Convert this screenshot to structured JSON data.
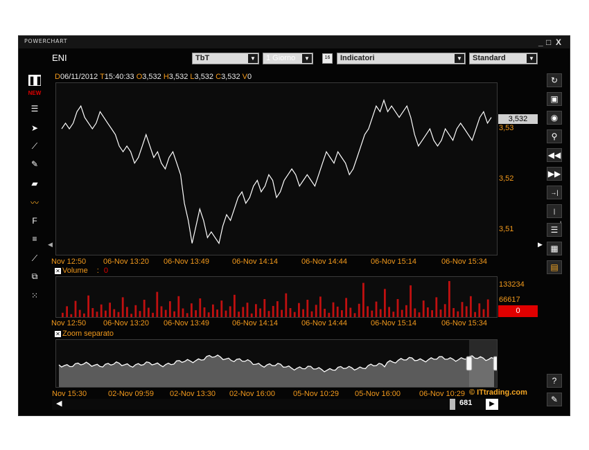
{
  "window": {
    "title": "POWERCHART",
    "controls": [
      "_",
      "□",
      "X"
    ]
  },
  "header": {
    "symbol": "ENI",
    "mode": "TbT",
    "period": "1 Giorno",
    "indicators": "Indicatori",
    "style": "Standard"
  },
  "ohlc": {
    "d_key": "D",
    "d_val": "06/11/2012",
    "t_key": "T",
    "t_val": "15:40:33",
    "o_key": "O",
    "o_val": "3,532",
    "h_key": "H",
    "h_val": "3,532",
    "l_key": "L",
    "l_val": "3,532",
    "c_key": "C",
    "c_val": "3,532",
    "v_key": "V",
    "v_val": "0"
  },
  "main_chart": {
    "last_price": "3,532",
    "y_ticks": [
      "3,53",
      "3,52",
      "3,51"
    ],
    "x_ticks": [
      "Nov 12:50",
      "06-Nov 13:20",
      "06-Nov 13:49",
      "06-Nov 14:14",
      "06-Nov 14:44",
      "06-Nov 15:14",
      "06-Nov 15:34"
    ]
  },
  "volume_panel": {
    "title": "Volume",
    "sep": ":",
    "value": "0",
    "y_ticks": [
      "133234",
      "66617"
    ],
    "current": "0",
    "x_ticks": [
      "Nov 12:50",
      "06-Nov 13:20",
      "06-Nov 13:49",
      "06-Nov 14:14",
      "06-Nov 14:44",
      "06-Nov 15:14",
      "06-Nov 15:34"
    ]
  },
  "zoom_panel": {
    "title": "Zoom separato",
    "x_ticks": [
      "Nov 15:30",
      "02-Nov 09:59",
      "02-Nov 13:30",
      "02-Nov 16:00",
      "05-Nov 10:29",
      "05-Nov 16:00",
      "06-Nov 10:29"
    ]
  },
  "footer": {
    "brand": "© ITtrading.com",
    "count": "681"
  },
  "left_toolbar": {
    "new_badge": "NEW"
  },
  "colors": {
    "accent": "#f39a1c",
    "volume": "#c01010",
    "price_line": "#ffffff",
    "background": "#050505"
  },
  "chart_data": {
    "type": "line",
    "series": [
      {
        "values": [
          3.53,
          3.531,
          3.53,
          3.531,
          3.533,
          3.534,
          3.532,
          3.531,
          3.53,
          3.531,
          3.533,
          3.532,
          3.531,
          3.53,
          3.529,
          3.527,
          3.526,
          3.527,
          3.526,
          3.524,
          3.525,
          3.527,
          3.529,
          3.527,
          3.525,
          3.526,
          3.524,
          3.523,
          3.525,
          3.526,
          3.524,
          3.522,
          3.517,
          3.514,
          3.51,
          3.513,
          3.516,
          3.514,
          3.511,
          3.512,
          3.511,
          3.51,
          3.513,
          3.515,
          3.514,
          3.516,
          3.518,
          3.519,
          3.517,
          3.518,
          3.52,
          3.521,
          3.519,
          3.52,
          3.522,
          3.521,
          3.518,
          3.519,
          3.521,
          3.522,
          3.523,
          3.522,
          3.52,
          3.521,
          3.522,
          3.521,
          3.52,
          3.522,
          3.524,
          3.526,
          3.525,
          3.524,
          3.526,
          3.525,
          3.524,
          3.522,
          3.523,
          3.525,
          3.527,
          3.529,
          3.53,
          3.532,
          3.534,
          3.533,
          3.535,
          3.533,
          3.534,
          3.533,
          3.532,
          3.533,
          3.534,
          3.532,
          3.529,
          3.527,
          3.528,
          3.529,
          3.53,
          3.528,
          3.527,
          3.528,
          3.53,
          3.529,
          3.528,
          3.53,
          3.531,
          3.53,
          3.529,
          3.528,
          3.53,
          3.532,
          3.533,
          3.531,
          3.532
        ]
      }
    ],
    "ylim": [
      3.508,
      3.538
    ],
    "volume": [
      12,
      30,
      8,
      45,
      20,
      10,
      60,
      25,
      15,
      35,
      18,
      40,
      22,
      14,
      55,
      28,
      9,
      33,
      17,
      48,
      26,
      12,
      70,
      30,
      20,
      44,
      16,
      58,
      24,
      11,
      38,
      19,
      52,
      27,
      13,
      35,
      21,
      46,
      18,
      30,
      62,
      15,
      28,
      40,
      10,
      36,
      24,
      50,
      17,
      31,
      44,
      20,
      66,
      25,
      14,
      39,
      22,
      48,
      16,
      34,
      57,
      23,
      12,
      41,
      29,
      19,
      53,
      26,
      11,
      37,
      95,
      30,
      18,
      43,
      22,
      78,
      28,
      15,
      50,
      20,
      33,
      88,
      24,
      13,
      46,
      27,
      19,
      55,
      21,
      36,
      100,
      25,
      16,
      42,
      30,
      58,
      14,
      38,
      22,
      49
    ]
  }
}
